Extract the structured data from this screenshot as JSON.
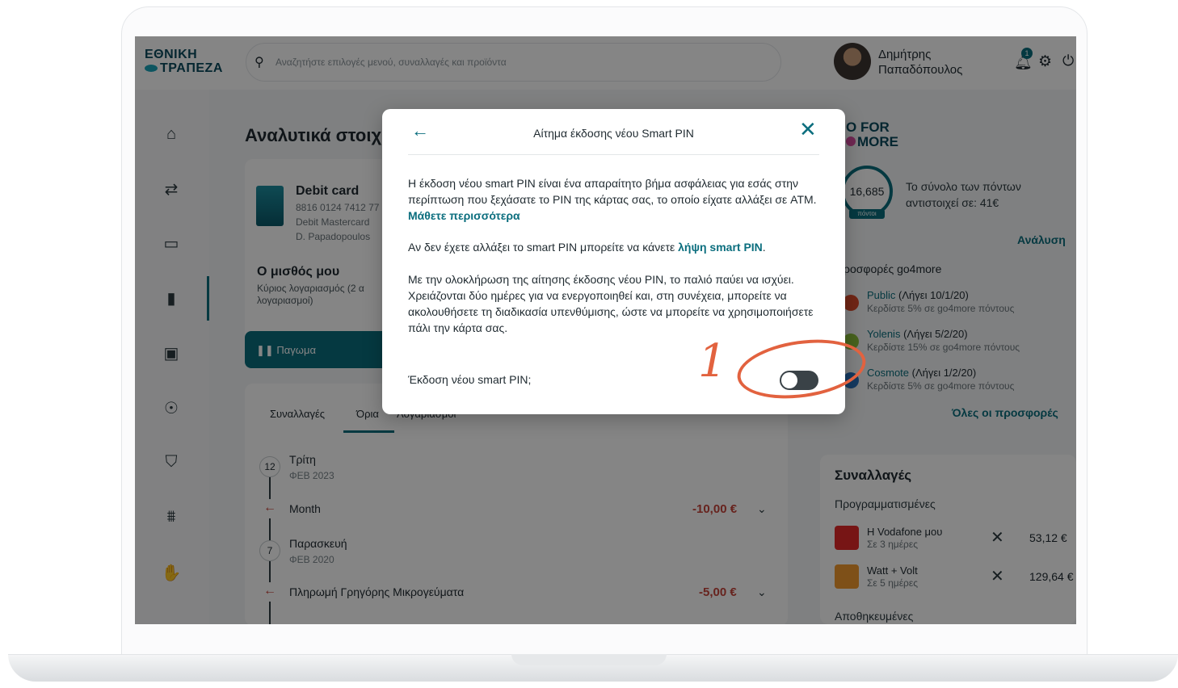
{
  "topbar": {
    "logo_line1": "ΕΘΝΙΚΗ",
    "logo_line2": "ΤΡΑΠΕΖΑ",
    "search_placeholder": "Αναζητήστε επιλογές μενού, συναλλαγές και προϊόντα",
    "user_first": "Δημήτρης",
    "user_last": "Παπαδόπουλος",
    "notification_count": "1"
  },
  "page": {
    "title": "Αναλυτικά στοιχ",
    "card_title": "Debit card",
    "card_number": "8816 0124 7412 77",
    "card_type": "Debit Mastercard",
    "card_holder": "D. Papadopoulos",
    "salary_title": "Ο μισθός μου",
    "salary_sub": "Κύριος λογαριασμός (2 α λογαριασμοί)",
    "freeze_label": "Παγωμα",
    "tabs": [
      "Συναλλαγές",
      "Όρια",
      "Λογαριασμοί"
    ],
    "days": [
      {
        "num": "12",
        "name": "Τρίτη",
        "date": "ΦΕΒ 2023"
      },
      {
        "num": "7",
        "name": "Παρασκευή",
        "date": "ΦΕΒ 2020"
      }
    ],
    "transactions": [
      {
        "name": "Month",
        "amount": "-10,00 €"
      },
      {
        "name": "Πληρωμή Γρηγόρης Μικρογεύματα",
        "amount": "-5,00 €"
      }
    ]
  },
  "go4more": {
    "brand_line1": "O FOR",
    "brand_line2": "MORE",
    "points": "16,685",
    "points_tag": "πόντοι",
    "points_text_1": "Το σύνολο των πόντων",
    "points_text_2": "αντιστοιχεί σε: 41€",
    "analysis_link": "Ανάλυση",
    "offers_heading": "ροσφορές go4more",
    "offers": [
      {
        "name": "Public",
        "expires": "(Λήγει 10/1/20)",
        "desc": "Κερδίστε 5% σε go4more πόντους",
        "color": "#d84a2a"
      },
      {
        "name": "Yolenis",
        "expires": "(Λήγει 5/2/20)",
        "desc": "Κερδίστε 15% σε go4more πόντους",
        "color": "#8bbf3a"
      },
      {
        "name": "Cosmote",
        "expires": "(Λήγει 1/2/20)",
        "desc": "Κερδίστε 5% σε go4more πόντους",
        "color": "#2a6fb8"
      }
    ],
    "all_offers": "Όλες οι προσφορές"
  },
  "transactions_card": {
    "title": "Συναλλαγές",
    "scheduled_heading": "Προγραμματισμένες",
    "scheduled": [
      {
        "name": "Η Vodafone μου",
        "when": "Σε 3 ημέρες",
        "amount": "53,12 €",
        "color": "#e52a2a"
      },
      {
        "name": "Watt + Volt",
        "when": "Σε 5 ημέρες",
        "amount": "129,64 €",
        "color": "#f29a2e"
      }
    ],
    "saved_heading": "Αποθηκευμένες"
  },
  "modal": {
    "title": "Αίτημα έκδοσης νέου Smart PIN",
    "para1": "Η έκδοση νέου smart PIN είναι ένα απαραίτητο βήμα ασφάλειας για εσάς στην περίπτωση που ξεχάσατε το PIN της κάρτας σας, το οποίο είχατε αλλάξει σε ATM.",
    "para1_link": "Μάθετε περισσότερα",
    "para2": "Αν δεν έχετε αλλάξει το smart PIN μπορείτε να κάνετε",
    "para2_link": "λήψη smart PIN",
    "para3": "Με την ολοκλήρωση της αίτησης έκδοσης νέου PIN, το παλιό παύει να ισχύει. Χρειάζονται δύο ημέρες για να ενεργοποιηθεί και, στη συνέχεια, μπορείτε να ακολουθήσετε τη διαδικασία υπενθύμισης, ώστε να μπορείτε να χρησιμοποιήσετε πάλι την κάρτα σας.",
    "toggle_label": "Έκδοση νέου smart PIN;",
    "toggle_on": false
  },
  "annotation": {
    "number": "1",
    "color": "#e2623f"
  }
}
